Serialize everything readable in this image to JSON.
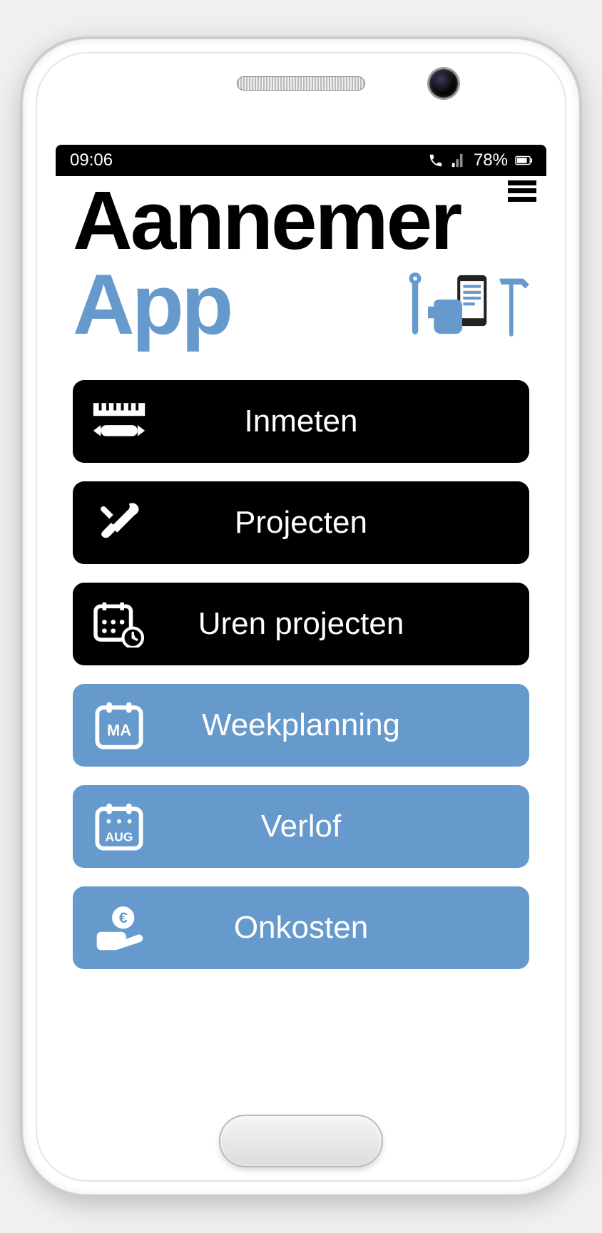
{
  "status": {
    "time": "09:06",
    "battery": "78%"
  },
  "logo": {
    "line1": "Aannemer",
    "line2": "App"
  },
  "colors": {
    "accent": "#6699cc",
    "dark": "#000000"
  },
  "menu": [
    {
      "label": "Inmeten",
      "variant": "black",
      "icon": "ruler-pencil-icon"
    },
    {
      "label": "Projecten",
      "variant": "black",
      "icon": "tools-icon"
    },
    {
      "label": "Uren projecten",
      "variant": "black",
      "icon": "calendar-clock-icon"
    },
    {
      "label": "Weekplanning",
      "variant": "blue",
      "icon": "calendar-ma-icon",
      "badge": "MA"
    },
    {
      "label": "Verlof",
      "variant": "blue",
      "icon": "calendar-aug-icon",
      "badge": "AUG"
    },
    {
      "label": "Onkosten",
      "variant": "blue",
      "icon": "hand-euro-icon"
    }
  ]
}
